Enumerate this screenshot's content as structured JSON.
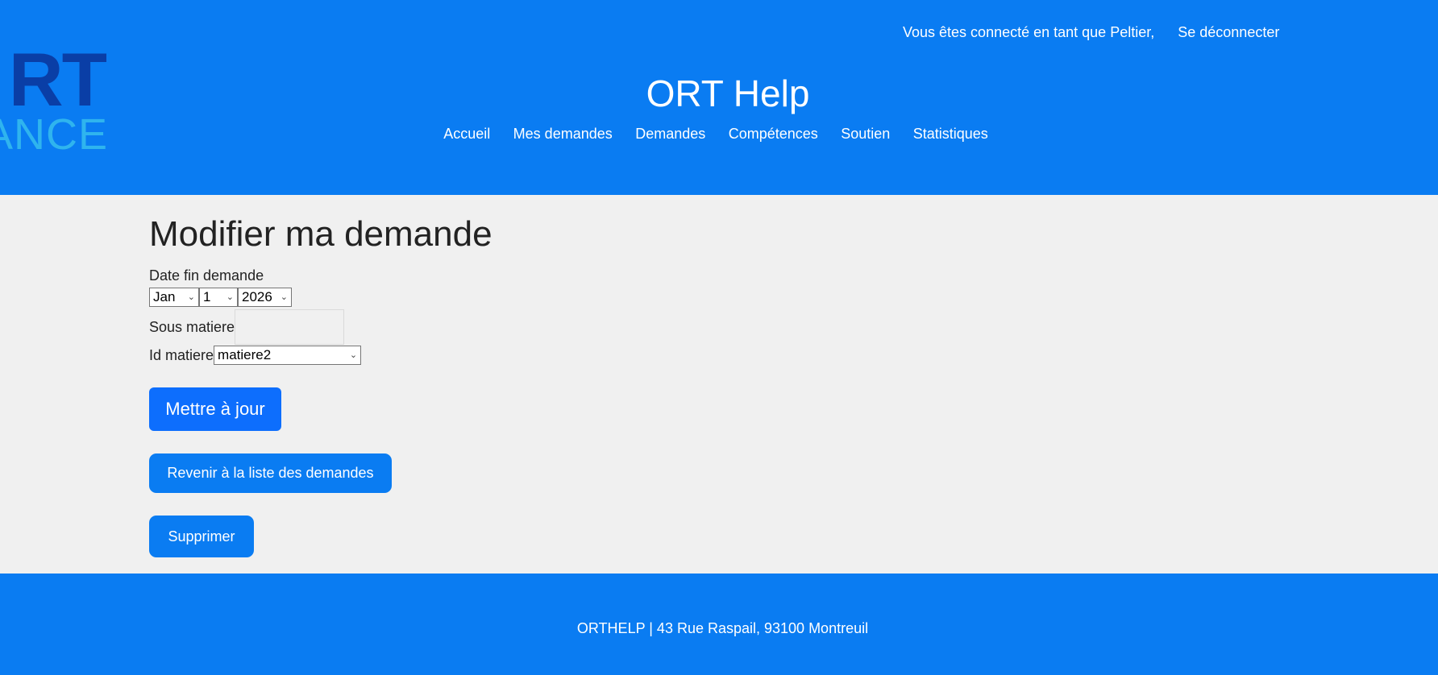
{
  "logo": {
    "top_text": "RT",
    "bottom_text": "ANCE"
  },
  "user": {
    "connected_text": "Vous êtes connecté en tant que Peltier,",
    "logout_label": "Se déconnecter"
  },
  "site_title": "ORT Help",
  "nav": {
    "items": [
      "Accueil",
      "Mes demandes",
      "Demandes",
      "Compétences",
      "Soutien",
      "Statistiques"
    ]
  },
  "page": {
    "title": "Modifier ma demande",
    "date_label": "Date fin demande",
    "date": {
      "month": "Jan",
      "day": "1",
      "year": "2026"
    },
    "sous_matiere_label": "Sous matiere",
    "sous_matiere_value": "",
    "id_matiere_label": "Id matiere",
    "id_matiere_value": "matiere2",
    "update_label": "Mettre à jour",
    "back_label": "Revenir à la liste des demandes",
    "delete_label": "Supprimer"
  },
  "footer": {
    "text": "ORTHELP | 43 Rue Raspail, 93100 Montreuil"
  },
  "colors": {
    "header_blue": "#0a7cf2",
    "primary_button": "#0d6efd",
    "background": "#f0f0f0"
  }
}
